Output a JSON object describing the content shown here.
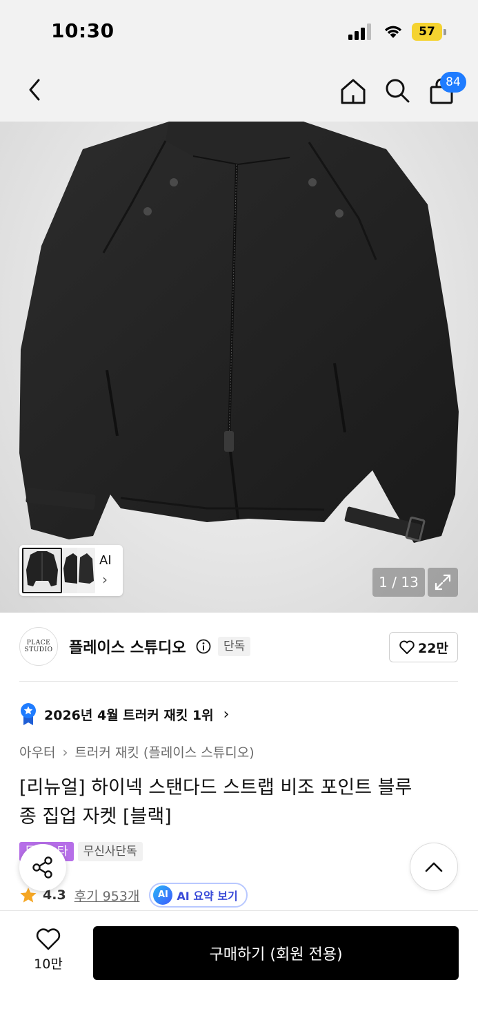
{
  "status_bar": {
    "time": "10:30",
    "battery": "57"
  },
  "nav": {
    "cart_count": "84"
  },
  "gallery": {
    "counter": "1 / 13",
    "thumb_ai_label": "AI",
    "thumb_chevron": "›"
  },
  "brand": {
    "logo_text": "PLACE STUDIO",
    "name": "플레이스 스튜디오",
    "exclusive_tag": "단독",
    "like_count": "22만"
  },
  "ranking": {
    "text": "2026년 4월 트러커 재킷 1위",
    "chevron": "›"
  },
  "breadcrumb": {
    "items": [
      "아우터",
      "트러커 재킷 (플레이스 스튜디오)"
    ],
    "separator": "›"
  },
  "product": {
    "title_line1": "[리뉴얼] 하이넥 스탠다드 스트랩 비조 포인트 블루",
    "title_line2": "종 집업 자켓 [블랙]"
  },
  "tags": {
    "tag1": "무진스타",
    "tag2": "무신사단독"
  },
  "rating": {
    "value": "4.3",
    "reviews": "후기 953개",
    "ai_badge": "AI",
    "ai_summary": "AI 요약 보기"
  },
  "bottom_bar": {
    "wish_count": "10만",
    "buy_label": "구매하기 (회원 전용)"
  },
  "colors": {
    "accent_blue": "#1f7cff",
    "tag_purple": "#b66ee8",
    "star": "#f5a623",
    "battery": "#f5d330"
  }
}
